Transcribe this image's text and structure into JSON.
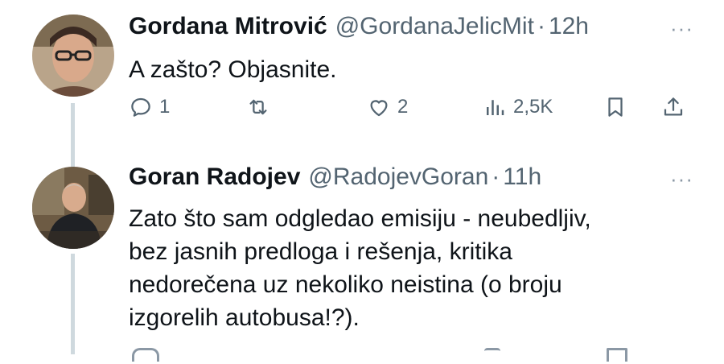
{
  "tweets": [
    {
      "author_name": "Gordana Mitrović",
      "handle": "@GordanaJelicMit",
      "separator": "·",
      "time": "12h",
      "more": "···",
      "text_lines": [
        "A zašto? Objasnite."
      ],
      "replies": "1",
      "likes": "2",
      "views": "2,5K"
    },
    {
      "author_name": "Goran Radojev",
      "handle": "@RadojevGoran",
      "separator": "·",
      "time": "11h",
      "more": "···",
      "text_lines": [
        "Zato što sam odgledao emisiju - neubedljiv,",
        "bez jasnih predloga i rešenja, kritika",
        "nedorečena uz nekoliko neistina (o broju",
        "izgorelih autobusa!?)."
      ]
    }
  ],
  "icons": [
    "reply-icon",
    "retweet-icon",
    "like-icon",
    "views-icon",
    "bookmark-icon",
    "share-icon",
    "more-icon"
  ],
  "colors": {
    "text": "#0f1419",
    "secondary": "#536471",
    "thread_line": "#cfd9de"
  }
}
